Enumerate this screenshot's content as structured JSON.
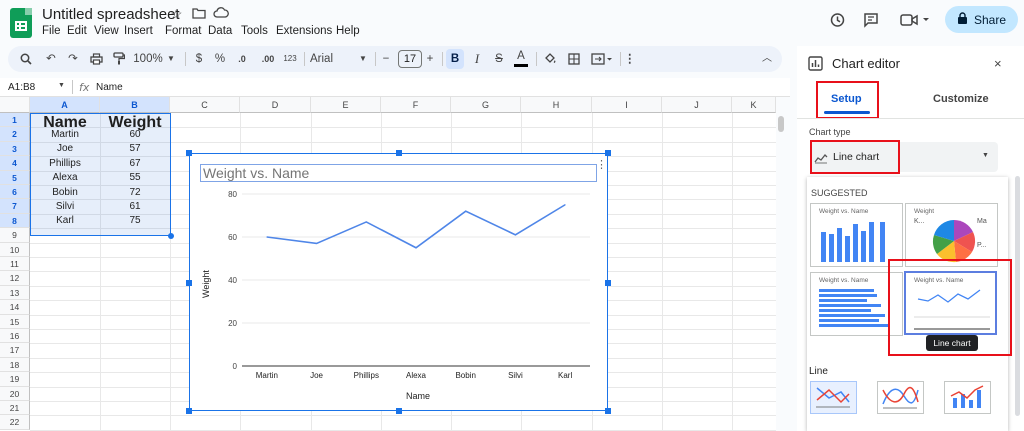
{
  "header": {
    "doc_title": "Untitled spreadsheet",
    "menu": [
      "File",
      "Edit",
      "View",
      "Insert",
      "Format",
      "Data",
      "Tools",
      "Extensions",
      "Help"
    ],
    "share_label": "Share"
  },
  "toolbar": {
    "zoom": "100%",
    "currency": "$",
    "percent": "%",
    "dec_minus": ".0",
    "dec_plus": ".00",
    "format_123": "123",
    "font": "Arial",
    "font_size": "17",
    "bold": "B",
    "italic": "I",
    "strike": "S",
    "text_color": "A"
  },
  "formula_bar": {
    "name_box": "A1:B8",
    "fx": "fx",
    "content": "Name"
  },
  "sheet": {
    "columns": [
      "A",
      "B",
      "C",
      "D",
      "E",
      "F",
      "G",
      "H",
      "I",
      "J",
      "K"
    ],
    "rows": [
      "1",
      "2",
      "3",
      "4",
      "5",
      "6",
      "7",
      "8",
      "9",
      "10",
      "11",
      "12",
      "13",
      "14",
      "15",
      "16",
      "17",
      "18",
      "19",
      "20",
      "21",
      "22"
    ],
    "headers": [
      "Name",
      "Weight"
    ],
    "data": [
      [
        "Martin",
        "60"
      ],
      [
        "Joe",
        "57"
      ],
      [
        "Phillips",
        "67"
      ],
      [
        "Alexa",
        "55"
      ],
      [
        "Bobin",
        "72"
      ],
      [
        "Silvi",
        "61"
      ],
      [
        "Karl",
        "75"
      ]
    ]
  },
  "chart_data": {
    "type": "line",
    "title": "Weight vs. Name",
    "xlabel": "Name",
    "ylabel": "Weight",
    "categories": [
      "Martin",
      "Joe",
      "Phillips",
      "Alexa",
      "Bobin",
      "Silvi",
      "Karl"
    ],
    "values": [
      60,
      57,
      67,
      55,
      72,
      61,
      75
    ],
    "ylim": [
      0,
      80
    ],
    "yticks": [
      "0",
      "20",
      "40",
      "60",
      "80"
    ],
    "grid": true,
    "line_color": "#4f86e8"
  },
  "panel": {
    "title": "Chart editor",
    "close": "×",
    "tabs": [
      "Setup",
      "Customize"
    ],
    "chart_type_label": "Chart type",
    "chart_type_value": "Line chart",
    "suggested_label": "SUGGESTED",
    "thumb_titles": [
      "Weight vs. Name",
      "Weight",
      "Weight vs. Name",
      "Weight vs. Name"
    ],
    "pie_legend": [
      "K...",
      "Ma",
      "P..."
    ],
    "tooltip": "Line chart",
    "line_section": "Line"
  },
  "colors": {
    "accent": "#0b57d0",
    "highlight": "#e8101a",
    "sheets_green": "#0f9d58"
  }
}
